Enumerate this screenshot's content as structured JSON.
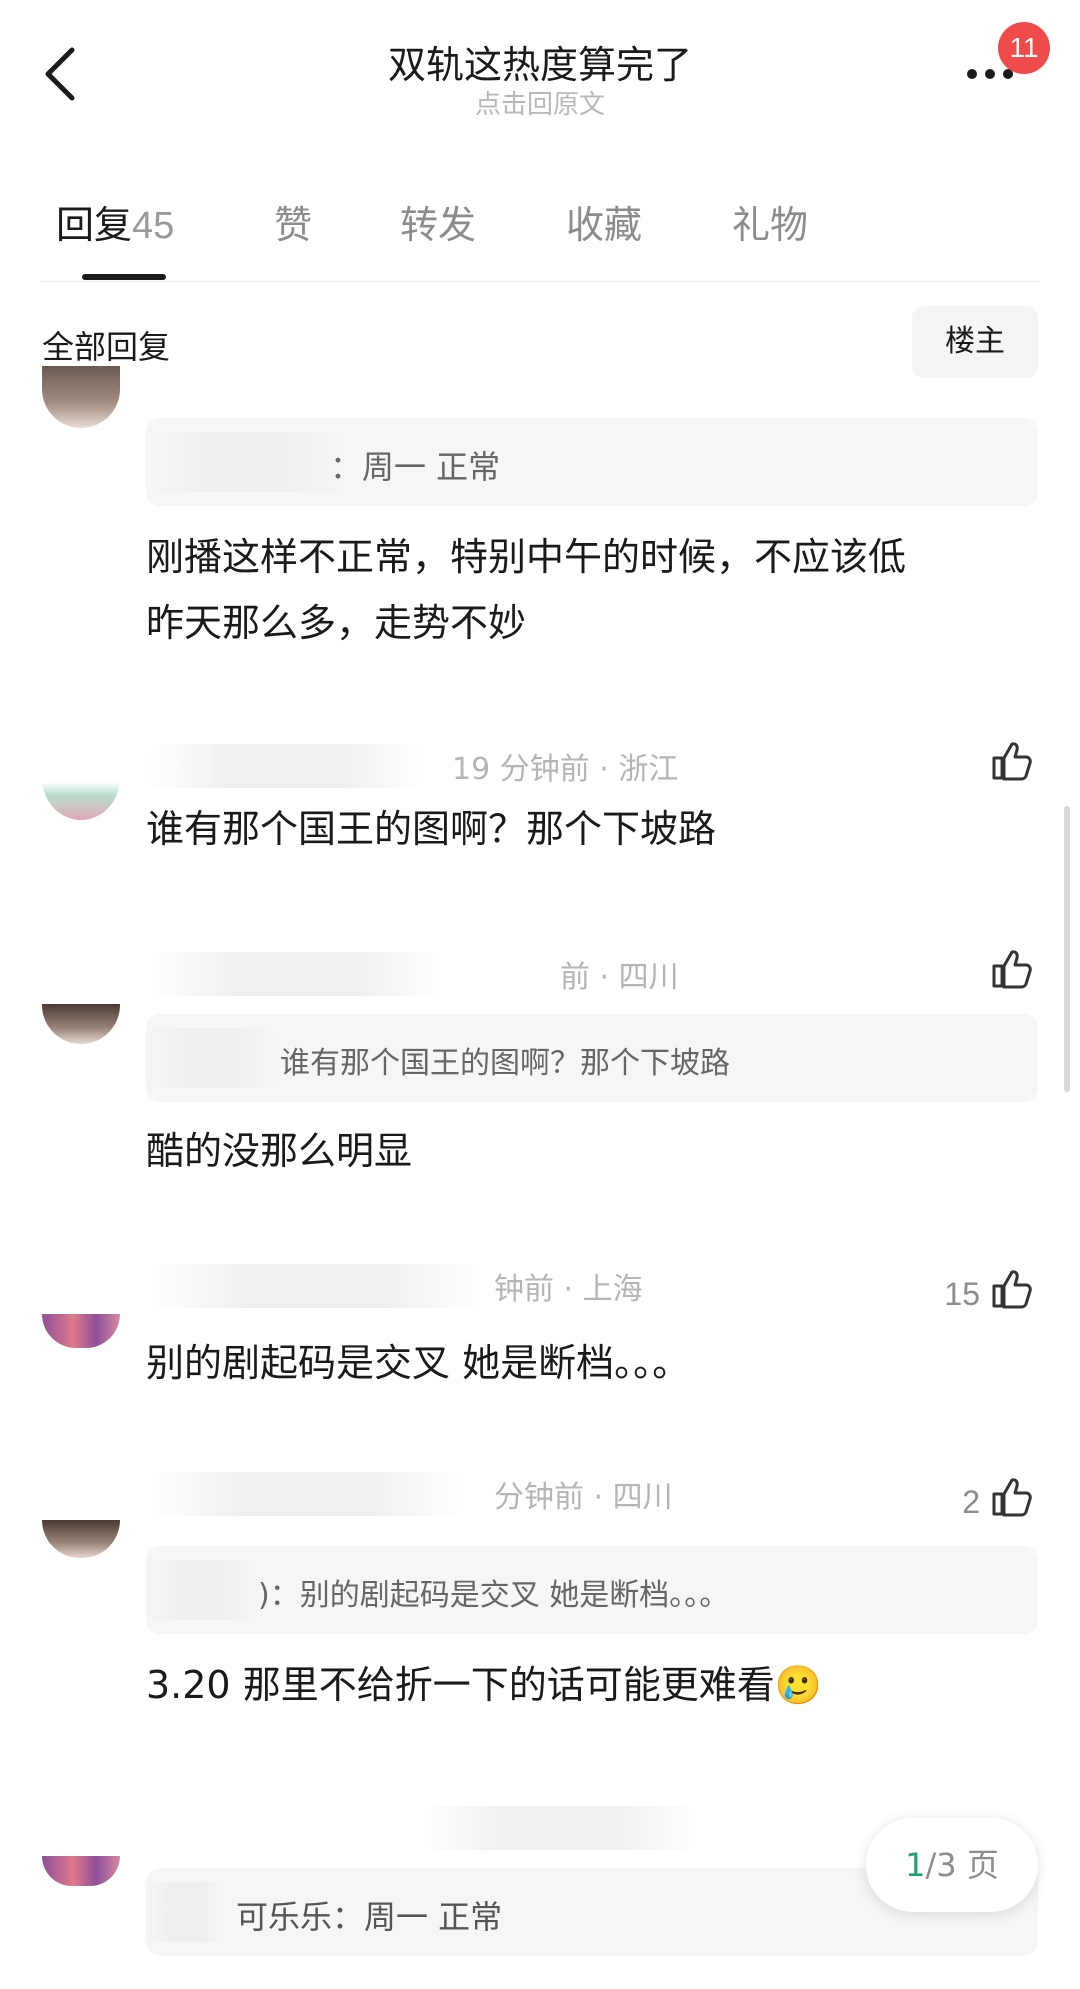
{
  "header": {
    "title": "双轨这热度算完了",
    "subtitle": "点击回原文",
    "notification_count": "11",
    "back_icon": "chevron-left-icon",
    "more_icon": "more-dots-icon"
  },
  "tabs": [
    {
      "label": "回复",
      "count": "45",
      "active": true
    },
    {
      "label": "赞"
    },
    {
      "label": "转发"
    },
    {
      "label": "收藏"
    },
    {
      "label": "礼物"
    }
  ],
  "section": {
    "title": "全部回复",
    "filter_button": "楼主"
  },
  "comments": [
    {
      "quote": "：周一 正常",
      "text_line1": "刚播这样不正常，特别中午的时候，不应该低",
      "text_line2": "昨天那么多，走势不妙"
    },
    {
      "meta": "19 分钟前 · 浙江",
      "text": "谁有那个国王的图啊？那个下坡路"
    },
    {
      "meta": "前 · 四川",
      "quote": "谁有那个国王的图啊？那个下坡路",
      "text": "酷的没那么明显"
    },
    {
      "meta": "钟前 · 上海",
      "likes": "15",
      "text": "别的剧起码是交叉 她是断档。。。"
    },
    {
      "meta": "分钟前 · 四川",
      "likes": "2",
      "quote": ")：别的剧起码是交叉 她是断档。。。",
      "text": "3.20 那里不给折一下的话可能更难看",
      "emoji": "🥲"
    },
    {
      "quote": "可乐乐：周一 正常"
    }
  ],
  "pager": {
    "current": "1",
    "total_label": "/3 页"
  },
  "colors": {
    "badge": "#ef4b4b",
    "pager_current": "#22a06b"
  }
}
